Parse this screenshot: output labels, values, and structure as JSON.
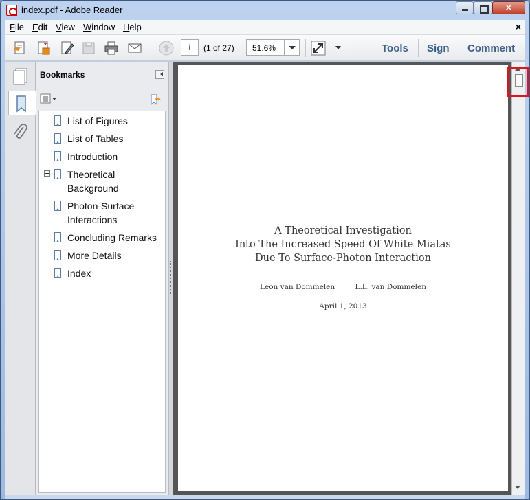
{
  "window": {
    "title": "index.pdf - Adobe Reader"
  },
  "menubar": {
    "items": [
      {
        "label": "File",
        "accel": "F",
        "rest": "ile"
      },
      {
        "label": "Edit",
        "accel": "E",
        "rest": "dit"
      },
      {
        "label": "View",
        "accel": "V",
        "rest": "iew"
      },
      {
        "label": "Window",
        "accel": "W",
        "rest": "indow"
      },
      {
        "label": "Help",
        "accel": "H",
        "rest": "elp"
      }
    ],
    "close_glyph": "×"
  },
  "toolbar": {
    "page_value": "i",
    "page_count": "(1 of 27)",
    "zoom_value": "51.6%",
    "links": {
      "tools": "Tools",
      "sign": "Sign",
      "comment": "Comment"
    }
  },
  "bookmarks": {
    "title": "Bookmarks",
    "items": [
      {
        "label": "List of Figures",
        "expandable": false
      },
      {
        "label": "List of Tables",
        "expandable": false
      },
      {
        "label": "Introduction",
        "expandable": false
      },
      {
        "label": "Theoretical Background",
        "expandable": true
      },
      {
        "label": "Photon-Surface Interactions",
        "expandable": false
      },
      {
        "label": "Concluding Remarks",
        "expandable": false
      },
      {
        "label": "More Details",
        "expandable": false
      },
      {
        "label": "Index",
        "expandable": false
      }
    ]
  },
  "document": {
    "title_lines": [
      "A Theoretical Investigation",
      "Into The Increased Speed Of White Miatas",
      "Due To Surface-Photon Interaction"
    ],
    "authors": [
      "Leon van Dommelen",
      "L.L. van Dommelen"
    ],
    "date": "April 1, 2013"
  },
  "colors": {
    "accent_link": "#3f5f8a",
    "highlight": "#e0141e"
  }
}
